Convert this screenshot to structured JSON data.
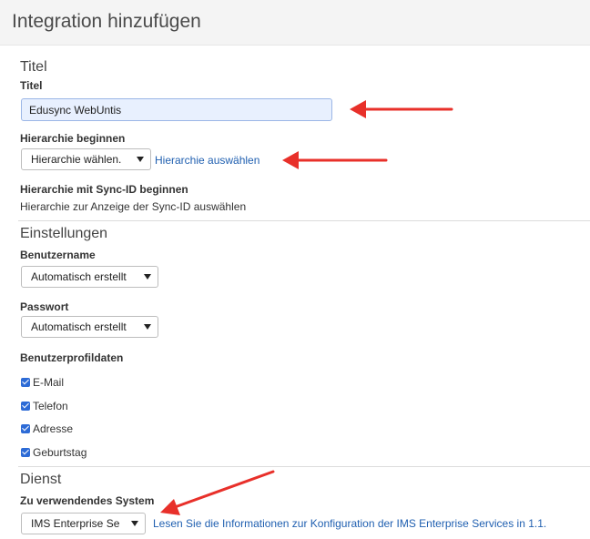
{
  "page": {
    "title": "Integration hinzufügen"
  },
  "sections": {
    "titel": {
      "heading": "Titel",
      "label": "Titel",
      "input_value": "Edusync WebUntis"
    },
    "hierarchy": {
      "label": "Hierarchie beginnen",
      "select_value": "Hierarchie wählen.",
      "link_text": "Hierarchie auswählen"
    },
    "sync_hierarchy": {
      "label": "Hierarchie mit Sync-ID beginnen",
      "text": "Hierarchie zur Anzeige der Sync-ID auswählen"
    },
    "settings": {
      "heading": "Einstellungen",
      "username_label": "Benutzername",
      "username_value": "Automatisch erstellt",
      "password_label": "Passwort",
      "password_value": "Automatisch erstellt",
      "profile_label": "Benutzerprofildaten",
      "profile_items": [
        {
          "label": "E-Mail",
          "checked": true
        },
        {
          "label": "Telefon",
          "checked": true
        },
        {
          "label": "Adresse",
          "checked": true
        },
        {
          "label": "Geburtstag",
          "checked": true
        }
      ]
    },
    "service": {
      "heading": "Dienst",
      "system_label": "Zu verwendendes System",
      "system_value": "IMS Enterprise Se",
      "info_link": "Lesen Sie die Informationen zur Konfiguration der IMS Enterprise Services in 1.1."
    }
  },
  "colors": {
    "annotation_arrow": "#e8302a",
    "link": "#1f5fb0",
    "checkbox": "#2d6bd6",
    "input_bg": "#e8f0fe"
  }
}
